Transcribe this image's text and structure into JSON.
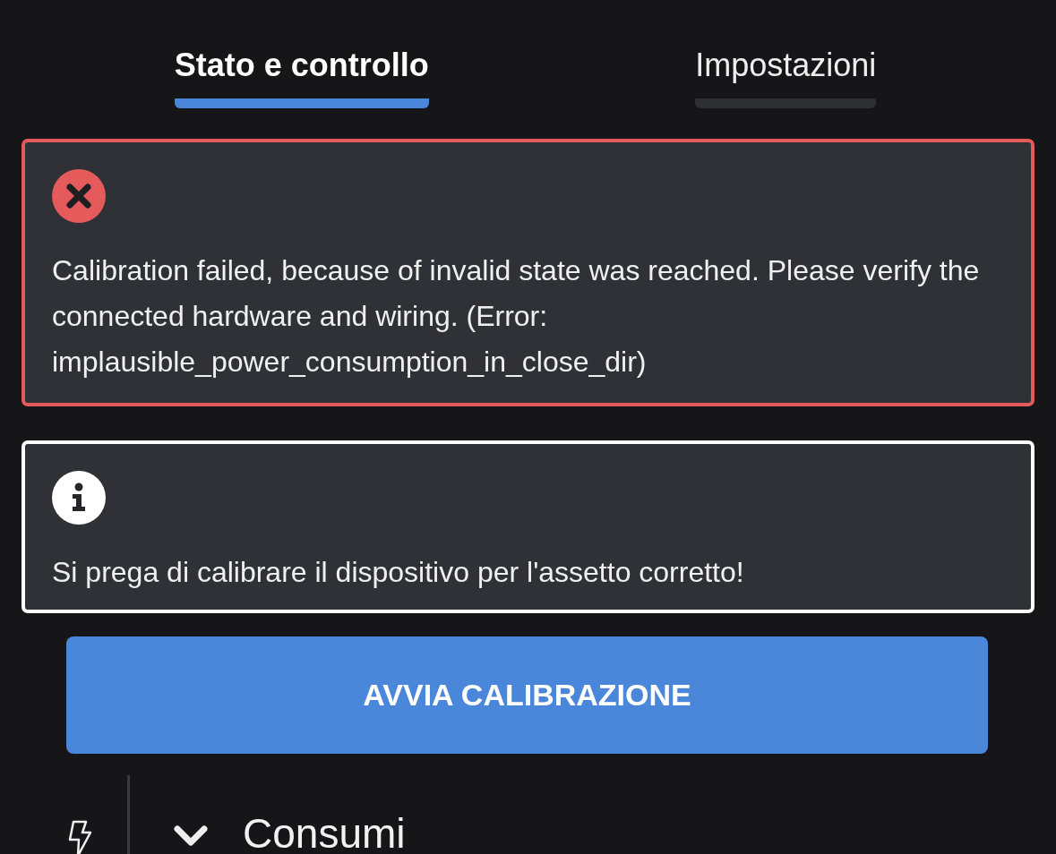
{
  "tabs": [
    {
      "label": "Stato e controllo",
      "selected": true
    },
    {
      "label": "Impostazioni",
      "selected": false
    }
  ],
  "alerts": [
    {
      "kind": "error",
      "message": "Calibration failed, because of invalid state was reached. Please verify the connected hardware and wiring. (Error: implausible_power_consumption_in_close_dir)"
    },
    {
      "kind": "info",
      "message": "Si prega di calibrare il dispositivo per l'assetto corretto!"
    }
  ],
  "button": {
    "label": "AVVIA CALIBRAZIONE"
  },
  "section": {
    "title": "Consumi"
  }
}
